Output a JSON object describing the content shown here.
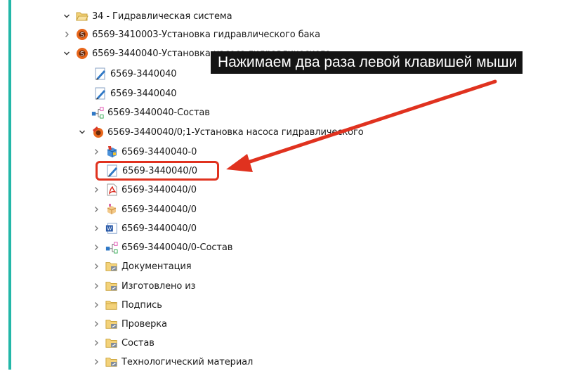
{
  "tooltip": "Нажимаем два раза левой клавишей мыши",
  "colors": {
    "accent_bar": "#23b7a8",
    "highlight": "#e0321f",
    "arrow": "#e0321f",
    "tooltip_bg": "#141414",
    "folder": "#e8c15a"
  },
  "tree": [
    {
      "label": "34 - Гидравлическая система",
      "icon": "folder-open-icon",
      "expanded": true
    },
    {
      "label": "6569-3410003-Установка гидравлического бака",
      "icon": "assembly-icon",
      "expanded": false
    },
    {
      "label": "6569-3440040-Установка насоса гидравлического",
      "icon": "assembly-icon",
      "expanded": true
    },
    {
      "label": "6569-3440040",
      "icon": "document-edit-icon"
    },
    {
      "label": "6569-3440040",
      "icon": "document-edit-icon"
    },
    {
      "label": "6569-3440040-Состав",
      "icon": "structure-icon"
    },
    {
      "label": "6569-3440040/0;1-Установка насоса гидравлического",
      "icon": "assembly-version-icon",
      "expanded": true
    },
    {
      "label": "6569-3440040-0",
      "icon": "model-icon",
      "expanded": false
    },
    {
      "label": "6569-3440040/0",
      "icon": "document-edit-icon",
      "selected": true
    },
    {
      "label": "6569-3440040/0",
      "icon": "pdf-icon",
      "expanded": false
    },
    {
      "label": "6569-3440040/0",
      "icon": "part-icon",
      "expanded": false
    },
    {
      "label": "6569-3440040/0",
      "icon": "word-document-icon",
      "expanded": false
    },
    {
      "label": "6569-3440040/0-Состав",
      "icon": "structure-icon",
      "expanded": false
    },
    {
      "label": "Документация",
      "icon": "folder-link-icon",
      "expanded": false
    },
    {
      "label": "Изготовлено из",
      "icon": "folder-link-icon",
      "expanded": false
    },
    {
      "label": "Подпись",
      "icon": "folder-icon",
      "expanded": false
    },
    {
      "label": "Проверка",
      "icon": "folder-link-icon",
      "expanded": false
    },
    {
      "label": "Состав",
      "icon": "folder-link-icon",
      "expanded": false
    },
    {
      "label": "Технологический материал",
      "icon": "folder-link-icon",
      "expanded": false
    }
  ]
}
